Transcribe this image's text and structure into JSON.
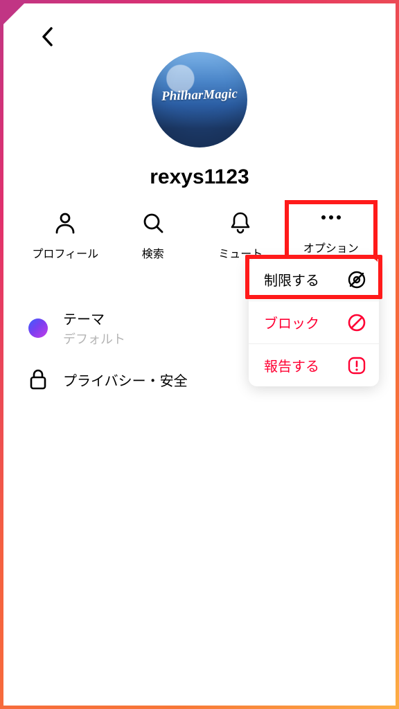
{
  "profile": {
    "username": "rexys1123"
  },
  "actions": {
    "profile": "プロフィール",
    "search": "検索",
    "mute": "ミュート",
    "options": "オプション"
  },
  "settings": {
    "theme": {
      "title": "テーマ",
      "sub": "デフォルト"
    },
    "privacy": {
      "title": "プライバシー・安全"
    }
  },
  "menu": {
    "restrict": "制限する",
    "block": "ブロック",
    "report": "報告する"
  }
}
